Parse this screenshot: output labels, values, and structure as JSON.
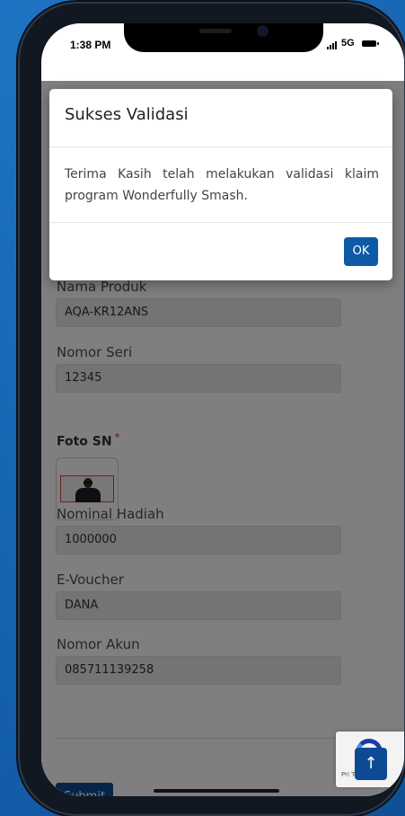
{
  "status_bar": {
    "time": "1:38 PM",
    "network": "5G"
  },
  "form": {
    "fields": [
      {
        "label": "Nama Produk",
        "value": "AQA-KR12ANS"
      },
      {
        "label": "Nomor Seri",
        "value": "12345"
      },
      {
        "label": "Nominal Hadiah",
        "value": "1000000"
      },
      {
        "label": "E-Voucher",
        "value": "DANA"
      },
      {
        "label": "Nomor Akun",
        "value": "085711139258"
      }
    ],
    "photo_label": "Foto SN",
    "required_marker": "*",
    "submit_label": "Submit"
  },
  "modal": {
    "title": "Sukses Validasi",
    "message": "Terima Kasih telah melakukan validasi klaim program Wonderfully Smash.",
    "ok_label": "OK"
  },
  "recaptcha": {
    "text": "Pri   Ter"
  },
  "back_to_top": {
    "glyph": "↑"
  },
  "colors": {
    "background": "#1565b2",
    "primary_button": "#0d4a93",
    "required": "#d9534f"
  }
}
